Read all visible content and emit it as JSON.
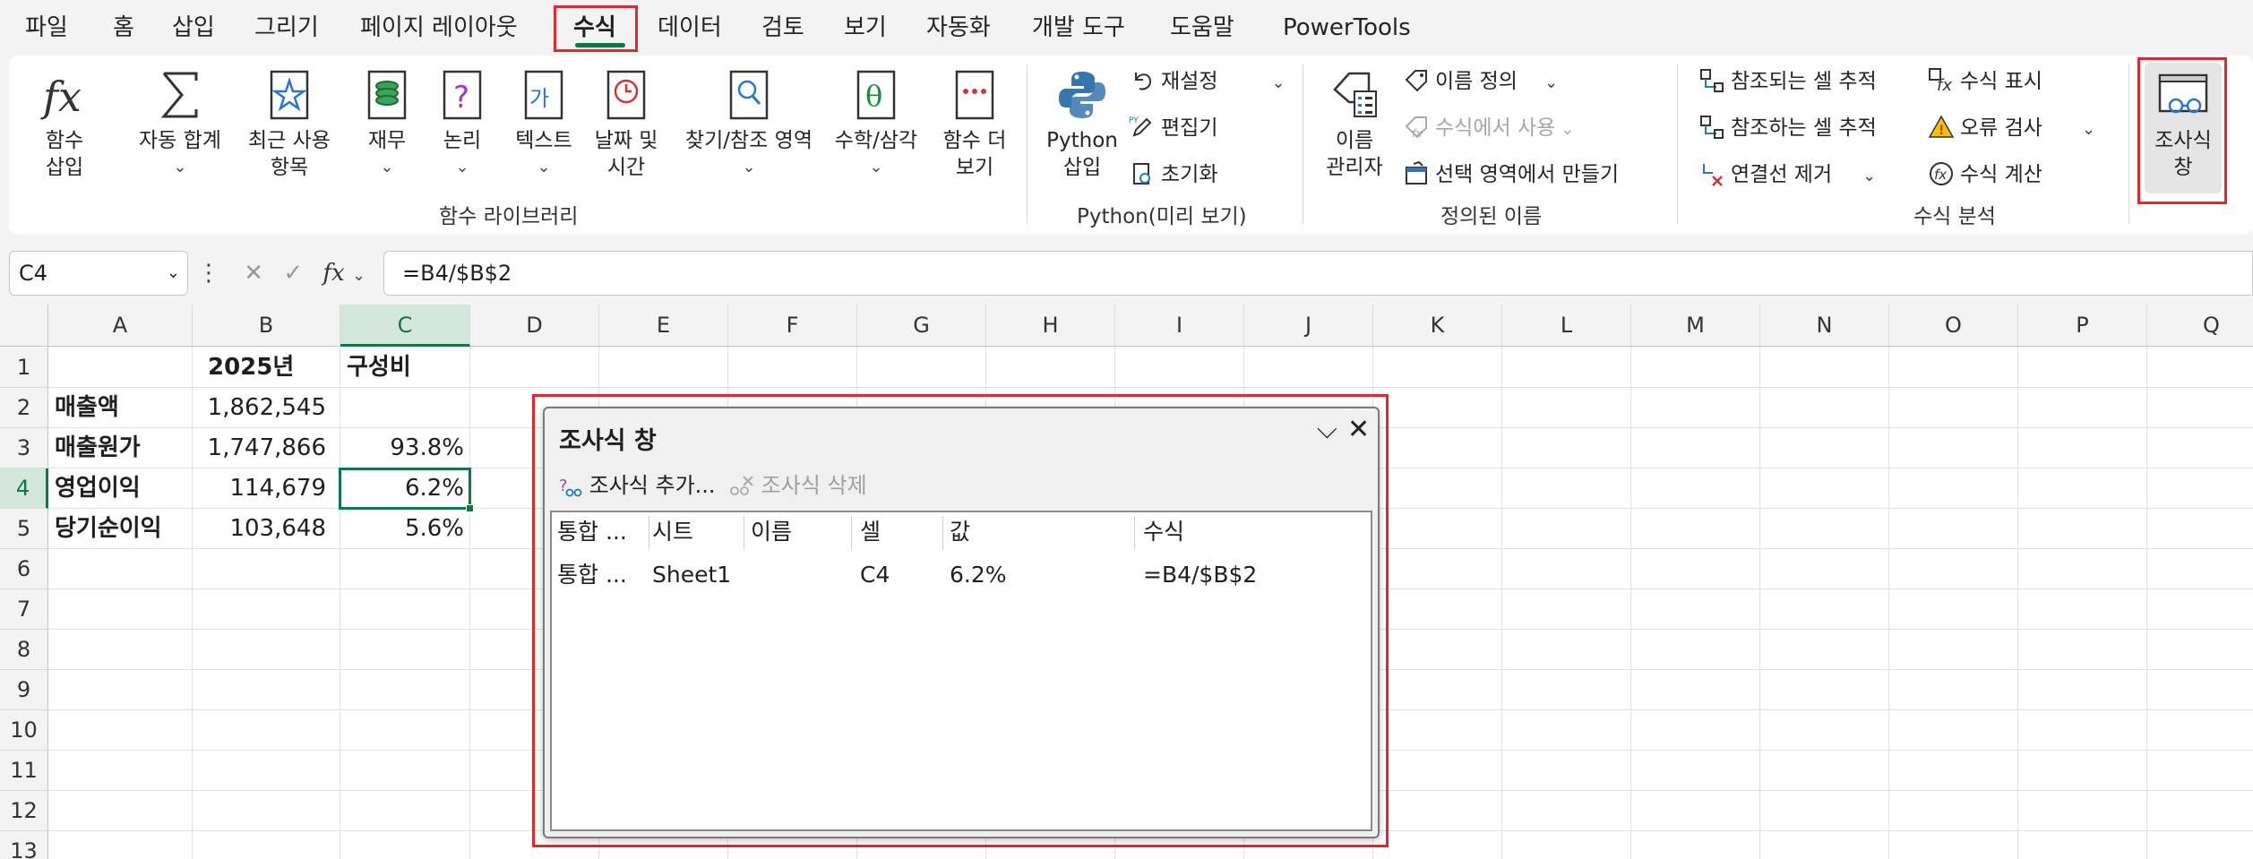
{
  "menu": {
    "items": [
      "파일",
      "홈",
      "삽입",
      "그리기",
      "페이지 레이아웃",
      "수식",
      "데이터",
      "검토",
      "보기",
      "자동화",
      "개발 도구",
      "도움말",
      "PowerTools"
    ],
    "active": "수식"
  },
  "ribbon": {
    "function_library": {
      "insert_function": "함수\n삽입",
      "autosum": "자동 합계",
      "recent": "최근 사용\n항목",
      "financial": "재무",
      "logical": "논리",
      "text": "텍스트",
      "datetime": "날짜 및\n시간",
      "lookup": "찾기/참조 영역",
      "math": "수학/삼각",
      "more": "함수 더\n보기",
      "label": "함수 라이브러리"
    },
    "python": {
      "insert": "Python\n삽입",
      "reset": "재설정",
      "editor": "편집기",
      "initialize": "초기화",
      "label": "Python(미리 보기)"
    },
    "defined_names": {
      "name_manager": "이름\n관리자",
      "define_name": "이름 정의",
      "use_in_formula": "수식에서 사용",
      "create_from_selection": "선택 영역에서 만들기",
      "label": "정의된 이름"
    },
    "formula_auditing": {
      "trace_precedents": "참조되는 셀 추적",
      "trace_dependents": "참조하는 셀 추적",
      "remove_arrows": "연결선 제거",
      "show_formulas": "수식 표시",
      "error_checking": "오류 검사",
      "evaluate_formula": "수식 계산",
      "watch_window": "조사식\n창",
      "label": "수식 분석"
    }
  },
  "formula_bar": {
    "name_box": "C4",
    "formula": "=B4/$B$2"
  },
  "sheet": {
    "columns": [
      "A",
      "B",
      "C",
      "D",
      "E",
      "F",
      "G",
      "H",
      "I",
      "J",
      "K",
      "L",
      "M",
      "N",
      "O",
      "P",
      "Q"
    ],
    "rows": [
      "1",
      "2",
      "3",
      "4",
      "5",
      "6",
      "7",
      "8",
      "9",
      "10",
      "11",
      "12",
      "13"
    ],
    "cells": {
      "B1": "2025년",
      "C1": "구성비",
      "A2": "매출액",
      "B2": "1,862,545",
      "A3": "매출원가",
      "B3": "1,747,866",
      "C3": "93.8%",
      "A4": "영업이익",
      "B4": "114,679",
      "C4": "6.2%",
      "A5": "당기순이익",
      "B5": "103,648",
      "C5": "5.6%"
    },
    "selected_cell": "C4"
  },
  "watch_window": {
    "title": "조사식 창",
    "add_watch": "조사식 추가...",
    "delete_watch": "조사식 삭제",
    "headers": [
      "통합 ...",
      "시트",
      "이름",
      "셀",
      "값",
      "수식"
    ],
    "rows": [
      [
        "통합 ...",
        "Sheet1",
        "",
        "C4",
        "6.2%",
        "=B4/$B$2"
      ]
    ]
  },
  "colors": {
    "accent": "#117745",
    "highlight": "#e6262e"
  }
}
